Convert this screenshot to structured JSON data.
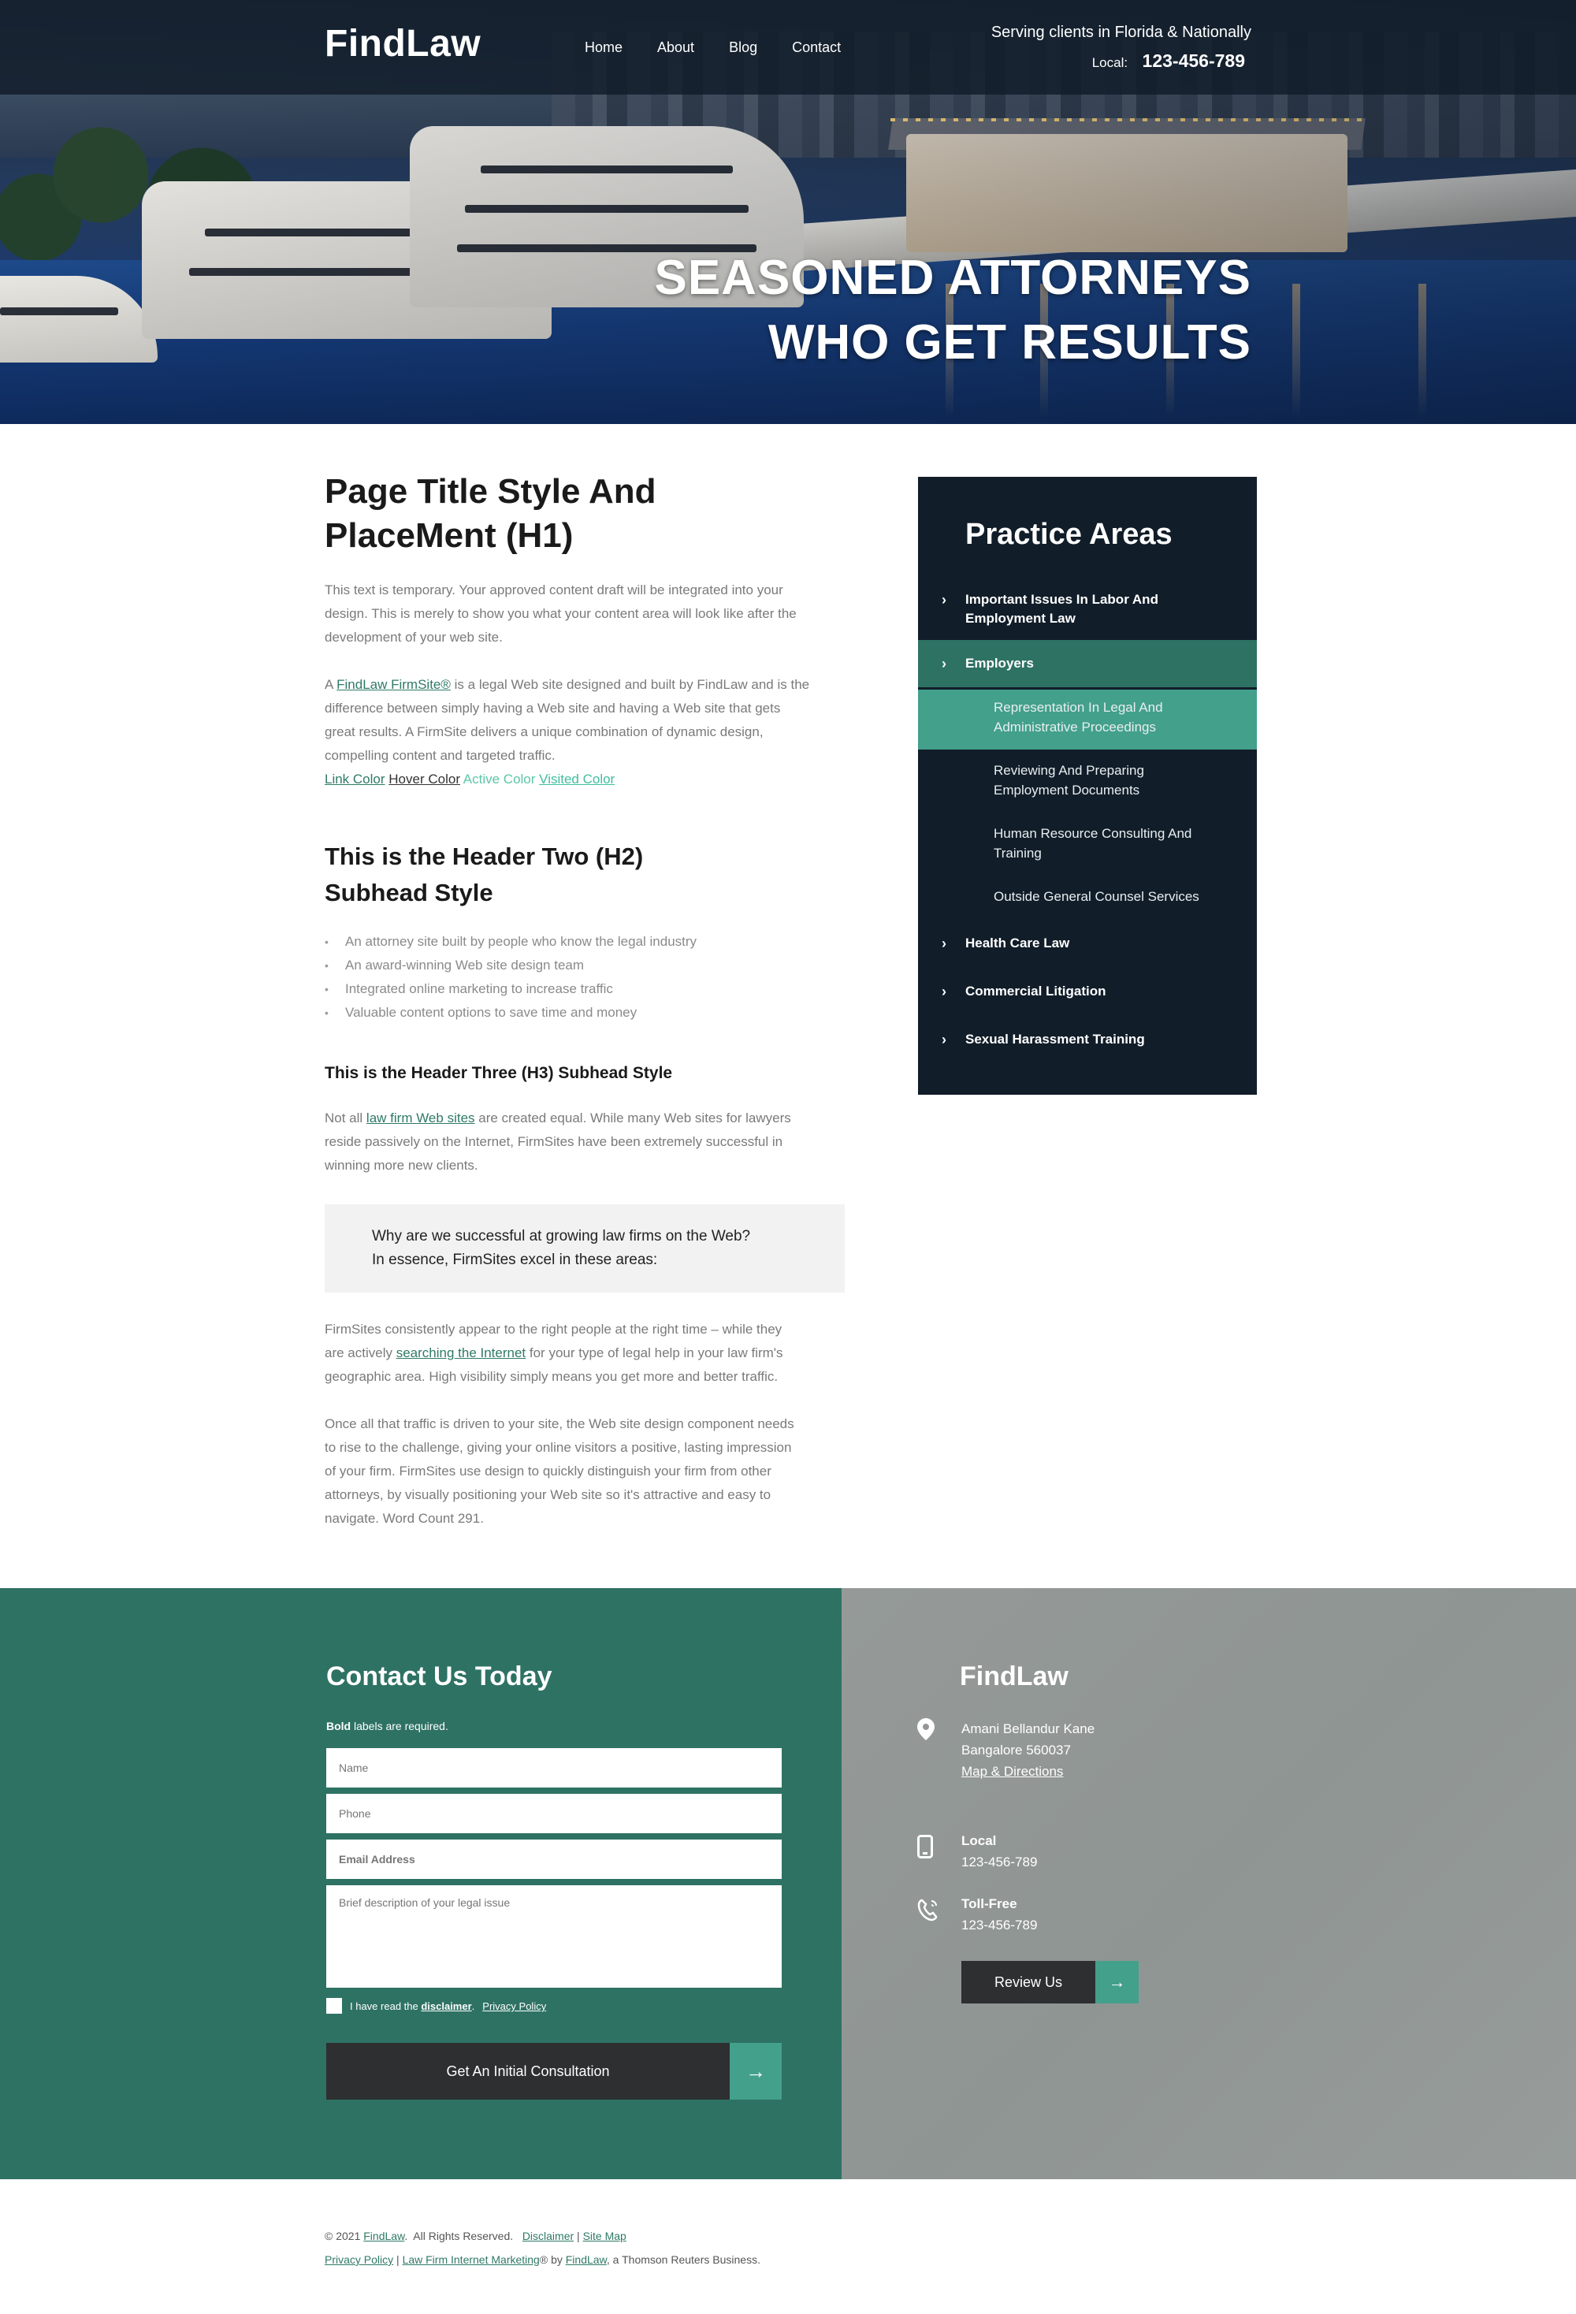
{
  "header": {
    "logo": "FindLaw",
    "nav": [
      "Home",
      "About",
      "Blog",
      "Contact"
    ],
    "serving": "Serving clients in Florida & Nationally",
    "local_label": "Local:",
    "phone": "123-456-789"
  },
  "hero": {
    "line1": "SEASONED ATTORNEYS",
    "line2": "WHO GET RESULTS"
  },
  "content": {
    "h1_line1": "Page Title Style And",
    "h1_line2": "PlaceMent (H1)",
    "intro_line1": "This text is temporary. Your approved content draft will be integrated into your",
    "intro_line2": "design. This is merely to show you what your content area will look like after the",
    "intro_line3": "development of your web site.",
    "p2_prefix": "A ",
    "p2_link": "FindLaw FirmSite®",
    "p2_line1": " is a legal Web site designed and built by FindLaw and is the",
    "p2_line2": "difference between simply having a Web site and having a Web site that gets",
    "p2_line3": "great results. A FirmSite delivers a unique combination of dynamic design,",
    "p2_line4": "compelling content and targeted traffic.",
    "link_color": "Link Color",
    "hover_color": "Hover Color",
    "active_color": "Active Color",
    "visited_color": "Visited Color",
    "h2_line1": "This is the Header Two (H2)",
    "h2_line2": "Subhead Style",
    "bullets": [
      "An attorney site built by people who know the legal industry",
      "An award-winning Web site design team",
      "Integrated online marketing to increase traffic",
      "Valuable content options to save time and money"
    ],
    "h3": "This is the Header Three (H3) Subhead Style",
    "p3_prefix": "Not all ",
    "p3_link": "law firm Web sites",
    "p3_line1": " are created equal. While many Web sites for lawyers",
    "p3_line2": "reside passively on the Internet, FirmSites have been extremely successful in",
    "p3_line3": "winning more new clients.",
    "quote_line1": "Why are we successful at growing law firms on the Web?",
    "quote_line2": "In essence, FirmSites excel in these areas:",
    "p4_line1": "FirmSites consistently appear to the right people at the right time – while they",
    "p4_prefix": "are actively ",
    "p4_link": "searching the Internet",
    "p4_line2": " for your type of legal help in your law firm's",
    "p4_line3": "geographic area. High visibility simply means you get more and better traffic.",
    "p5_line1": "Once all that traffic is driven to your site, the Web site design component needs",
    "p5_line2": "to rise to the challenge, giving your online visitors a positive, lasting impression",
    "p5_line3": "of your firm. FirmSites use design to quickly distinguish your firm from other",
    "p5_line4": "attorneys, by visually positioning your Web site so it's attractive and easy to",
    "p5_line5": "navigate. Word Count 291."
  },
  "sidebar": {
    "title": "Practice Areas",
    "item1_line1": "Important Issues In Labor And",
    "item1_line2": "Employment Law",
    "item2": "Employers",
    "sub1_line1": "Representation In Legal And",
    "sub1_line2": "Administrative Proceedings",
    "sub2_line1": "Reviewing And Preparing",
    "sub2_line2": "Employment Documents",
    "sub3_line1": "Human Resource Consulting And",
    "sub3_line2": "Training",
    "sub4": "Outside General Counsel Services",
    "item3": "Health Care Law",
    "item4": "Commercial Litigation",
    "item5": "Sexual Harassment Training",
    "colors": {
      "bg": "#111d29",
      "active": "#2e7264",
      "sub_active": "#43a08b"
    }
  },
  "contact_form": {
    "title": "Contact Us Today",
    "required_bold": "Bold",
    "required_rest": " labels are required.",
    "name_placeholder": "Name",
    "phone_placeholder": "Phone",
    "email_placeholder": "Email Address",
    "message_placeholder": "Brief description of your legal issue",
    "checkbox_prefix": "I have read the ",
    "disclaimer_link": "disclaimer",
    "checkbox_dot": ".",
    "privacy_link": "Privacy Policy",
    "submit": "Get An Initial Consultation",
    "arrow": "→"
  },
  "office": {
    "title": "FindLaw",
    "address_line1": "Amani Bellandur Kane",
    "address_line2": "Bangalore 560037",
    "map_link": "Map & Directions",
    "local_label": "Local",
    "local_phone": "123-456-789",
    "tollfree_label": "Toll-Free",
    "tollfree_phone": "123-456-789",
    "review_button": "Review Us",
    "arrow": "→"
  },
  "legal": {
    "copyright_prefix": "© 2021 ",
    "findlaw_link": "FindLaw",
    "rights": ".  All Rights Reserved.   ",
    "disclaimer": "Disclaimer",
    "sep": " | ",
    "site_map": "Site Map",
    "privacy": "Privacy Policy",
    "marketing": "Law Firm Internet Marketing",
    "by": "® by ",
    "findlaw_link2": "FindLaw",
    "thomson": ", a Thomson Reuters Business."
  }
}
